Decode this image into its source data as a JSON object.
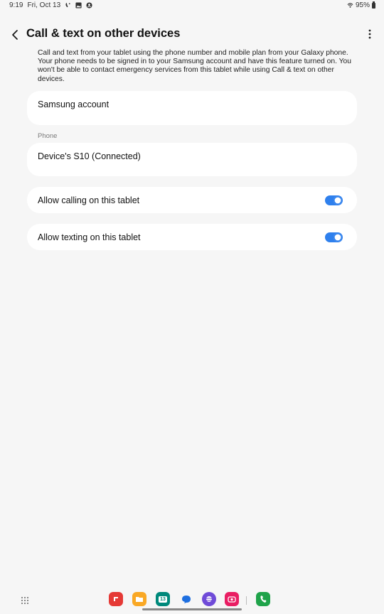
{
  "status_bar": {
    "time": "9:19",
    "date": "Fri, Oct 13",
    "battery": "95%"
  },
  "header": {
    "title": "Call & text on other devices"
  },
  "description": "Call and text from your tablet using the phone number and mobile plan from your Galaxy phone. Your phone needs to be signed in to your Samsung account and have this feature turned on. You won't be able to contact emergency services from this tablet while using Call & text on other devices.",
  "account": {
    "label": "Samsung account"
  },
  "phone_section": {
    "label": "Phone",
    "device": "Device's S10 (Connected)"
  },
  "settings": {
    "allow_calling": {
      "label": "Allow calling on this tablet",
      "on": true
    },
    "allow_texting": {
      "label": "Allow texting on this tablet",
      "on": true
    }
  },
  "dock": {
    "calendar_day": "13",
    "apps": [
      "app-drawer-icon",
      "flipboard-icon",
      "my-files-icon",
      "calendar-icon",
      "messages-icon",
      "internet-icon",
      "screen-recorder-icon",
      "phone-icon"
    ]
  },
  "colors": {
    "accent": "#2f80ed",
    "background": "#f6f6f6",
    "card": "#ffffff"
  }
}
